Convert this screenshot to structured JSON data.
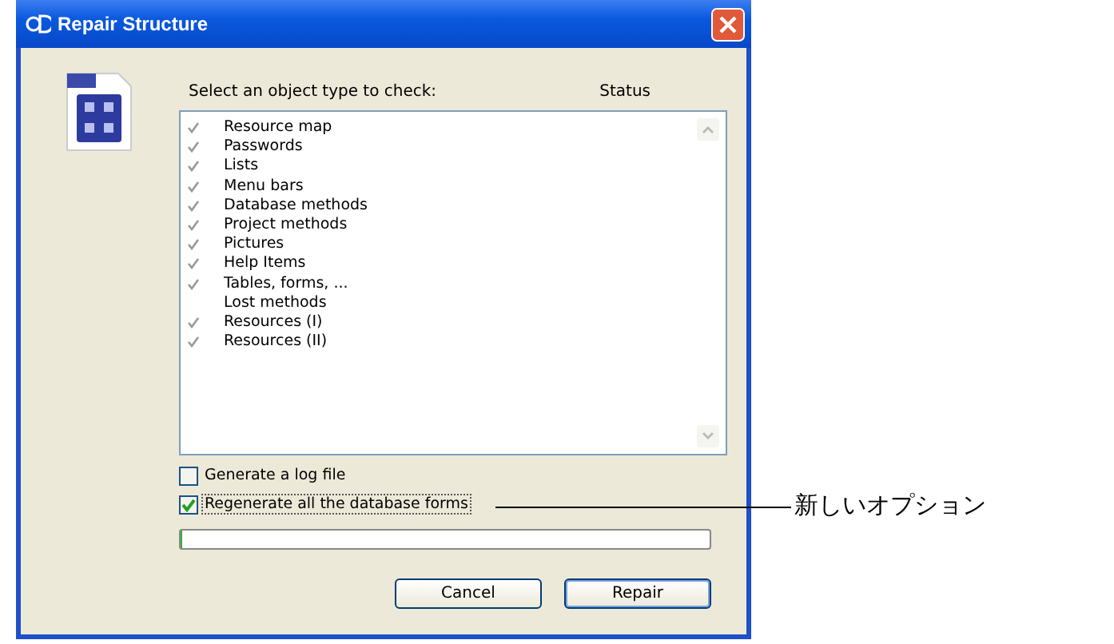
{
  "window": {
    "title": "Repair Structure"
  },
  "prompt": "Select an object type to check:",
  "status_heading": "Status",
  "items": [
    {
      "label": "Resource map",
      "checked": true
    },
    {
      "label": "Passwords",
      "checked": true
    },
    {
      "label": "Lists",
      "checked": true
    },
    {
      "label": "Menu bars",
      "checked": true
    },
    {
      "label": "Database methods",
      "checked": true
    },
    {
      "label": "Project methods",
      "checked": true
    },
    {
      "label": "Pictures",
      "checked": true
    },
    {
      "label": "Help Items",
      "checked": true
    },
    {
      "label": "Tables, forms, ...",
      "checked": true
    },
    {
      "label": "Lost methods",
      "checked": false
    },
    {
      "label": "Resources (I)",
      "checked": true
    },
    {
      "label": "Resources (II)",
      "checked": true
    }
  ],
  "options": [
    {
      "label": "Generate a log file",
      "checked": false
    },
    {
      "label": "Regenerate all the database forms",
      "checked": true
    }
  ],
  "progress": {
    "level": 0
  },
  "buttons": [
    "Cancel",
    "Repair"
  ],
  "callout": "新しいオプション"
}
